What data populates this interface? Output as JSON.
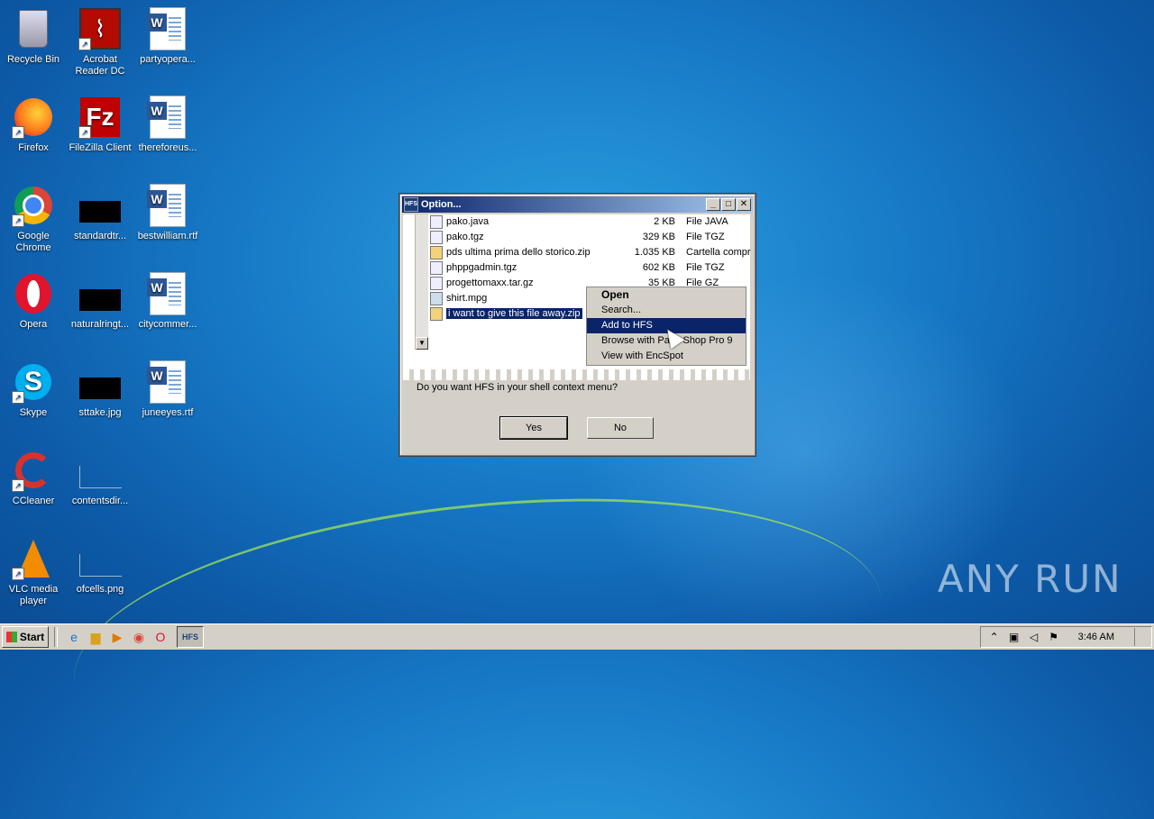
{
  "desktop": {
    "icons": [
      {
        "label": "Recycle Bin"
      },
      {
        "label": "Acrobat Reader DC"
      },
      {
        "label": "partyopera..."
      },
      {
        "label": "Firefox"
      },
      {
        "label": "FileZilla Client"
      },
      {
        "label": "thereforeus..."
      },
      {
        "label": "Google Chrome"
      },
      {
        "label": "standardtr..."
      },
      {
        "label": "bestwilliam.rtf"
      },
      {
        "label": "Opera"
      },
      {
        "label": "naturalringt..."
      },
      {
        "label": "citycommer..."
      },
      {
        "label": "Skype"
      },
      {
        "label": "sttake.jpg"
      },
      {
        "label": "juneeyes.rtf"
      },
      {
        "label": "CCleaner"
      },
      {
        "label": "contentsdir..."
      },
      {
        "label": "VLC media player"
      },
      {
        "label": "ofcells.png"
      }
    ]
  },
  "dialog": {
    "title": "Option...",
    "files": [
      {
        "name": "pako.java",
        "size": "2 KB",
        "type": "File JAVA"
      },
      {
        "name": "pako.tgz",
        "size": "329 KB",
        "type": "File TGZ"
      },
      {
        "name": "pds ultima prima dello storico.zip",
        "size": "1.035 KB",
        "type": "Cartella compr"
      },
      {
        "name": "phppgadmin.tgz",
        "size": "602 KB",
        "type": "File TGZ"
      },
      {
        "name": "progettomaxx.tar.gz",
        "size": "35 KB",
        "type": "File GZ"
      },
      {
        "name": "shirt.mpg",
        "size": "",
        "type": ""
      },
      {
        "name": "i want to give this file away.zip",
        "size": "",
        "type": ""
      }
    ],
    "context_menu": [
      "Open",
      "Search...",
      "Add to HFS",
      "Browse with Paint Shop Pro 9",
      "View with EncSpot"
    ],
    "question": "Do you want HFS in your shell context menu?",
    "yes_label": "Yes",
    "no_label": "No"
  },
  "taskbar": {
    "start_label": "Start",
    "hfs_label": "HFS",
    "clock": "3:46 AM"
  },
  "watermark": "ANY RUN"
}
